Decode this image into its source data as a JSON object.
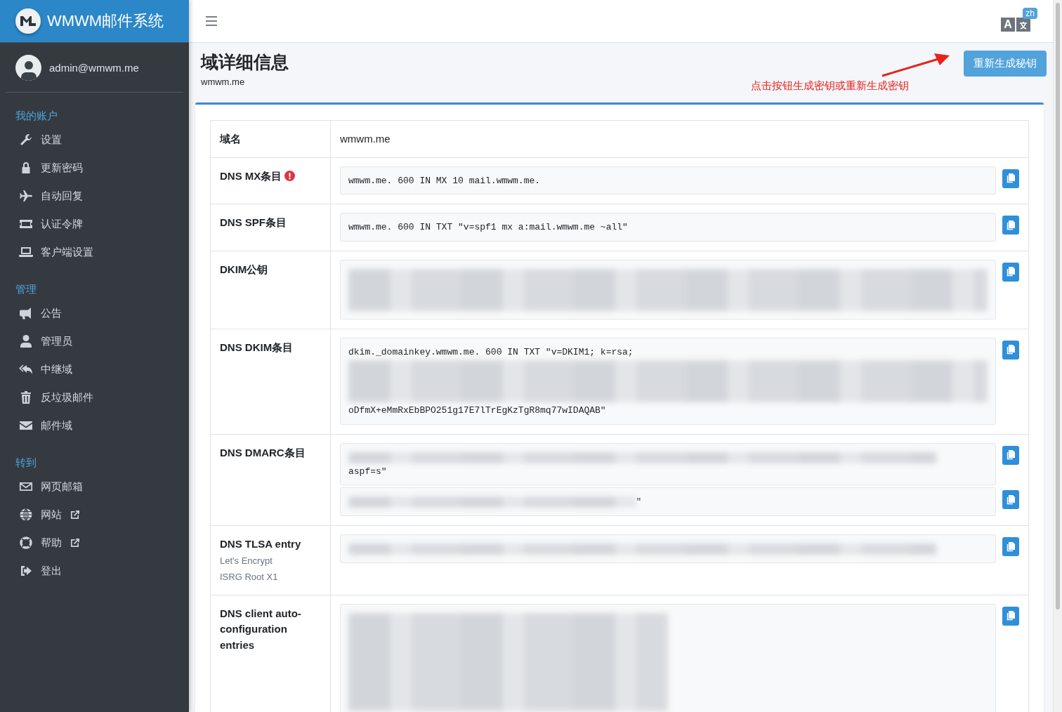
{
  "brand": {
    "title": "WMWM邮件系统"
  },
  "user": {
    "email": "admin@wmwm.me"
  },
  "sidebar": {
    "sections": [
      {
        "title": "我的账户",
        "items": [
          {
            "label": "设置",
            "external": false
          },
          {
            "label": "更新密码",
            "external": false
          },
          {
            "label": "自动回复",
            "external": false
          },
          {
            "label": "认证令牌",
            "external": false
          },
          {
            "label": "客户端设置",
            "external": false
          }
        ]
      },
      {
        "title": "管理",
        "items": [
          {
            "label": "公告",
            "external": false
          },
          {
            "label": "管理员",
            "external": false
          },
          {
            "label": "中继域",
            "external": false
          },
          {
            "label": "反垃圾邮件",
            "external": false
          },
          {
            "label": "邮件域",
            "external": false
          }
        ]
      },
      {
        "title": "转到",
        "items": [
          {
            "label": "网页邮箱",
            "external": false
          },
          {
            "label": "网站",
            "external": true
          },
          {
            "label": "帮助",
            "external": true
          },
          {
            "label": "登出",
            "external": false
          }
        ]
      }
    ]
  },
  "language": {
    "icon_glyph": "A",
    "badge": "zh"
  },
  "page": {
    "title": "域详细信息",
    "subtitle": "wmwm.me",
    "button": "重新生成秘钥",
    "annotation": "点击按钮生成密钥或重新生成密钥"
  },
  "details": [
    {
      "kind": "plain",
      "label": "域名",
      "value": "wmwm.me"
    },
    {
      "kind": "records",
      "label": "DNS MX条目",
      "warning": true,
      "records": [
        {
          "segments": [
            {
              "kind": "text",
              "text": "wmwm.me. 600 IN MX 10 mail.wmwm.me."
            }
          ]
        }
      ]
    },
    {
      "kind": "records",
      "label": "DNS SPF条目",
      "warning": false,
      "records": [
        {
          "segments": [
            {
              "kind": "text",
              "text": "wmwm.me. 600 IN TXT \"v=spf1 mx a:mail.wmwm.me ~all\""
            }
          ]
        }
      ]
    },
    {
      "kind": "records",
      "label": "DKIM公钥",
      "warning": false,
      "records": [
        {
          "segments": [
            {
              "kind": "blurblock"
            }
          ]
        }
      ]
    },
    {
      "kind": "records",
      "label": "DNS DKIM条目",
      "warning": false,
      "records": [
        {
          "segments": [
            {
              "kind": "text",
              "text": "dkim._domainkey.wmwm.me. 600 IN TXT \"v=DKIM1; k=rsa;"
            },
            {
              "kind": "blurblock"
            },
            {
              "kind": "text",
              "text": "oDfmX+eMmRxEbBPO251g17E7lTrEgKzTgR8mq77wIDAQAB\""
            }
          ]
        }
      ]
    },
    {
      "kind": "records",
      "label": "DNS DMARC条目",
      "warning": false,
      "records": [
        {
          "segments": [
            {
              "kind": "blurline"
            },
            {
              "kind": "text",
              "text": "aspf=s\""
            }
          ]
        },
        {
          "segments": [
            {
              "kind": "blurshort",
              "tail": "\""
            }
          ]
        }
      ]
    },
    {
      "kind": "records",
      "label": "DNS TLSA entry",
      "warning": false,
      "notes": [
        "Let's Encrypt",
        "ISRG Root X1"
      ],
      "records": [
        {
          "segments": [
            {
              "kind": "blurline"
            }
          ]
        }
      ]
    },
    {
      "kind": "records",
      "label": "DNS client auto-configuration entries",
      "warning": false,
      "records": [
        {
          "segments": [
            {
              "kind": "blurtall"
            }
          ]
        }
      ]
    }
  ]
}
